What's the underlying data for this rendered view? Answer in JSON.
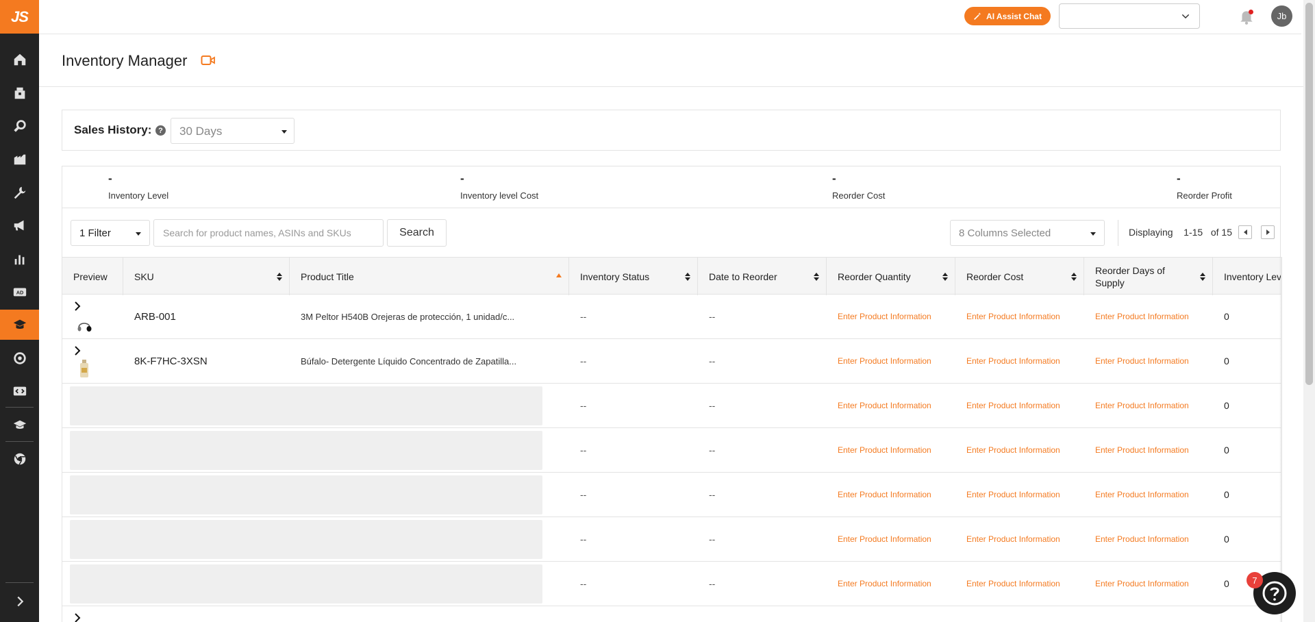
{
  "brand": {
    "logo_text": "JS",
    "accent": "#f47a20"
  },
  "topbar": {
    "ai_button": "AI Assist Chat",
    "marketplace_value": "",
    "avatar_initials": "Jb"
  },
  "page": {
    "title": "Inventory Manager"
  },
  "sales_history": {
    "label": "Sales History:",
    "help": "?",
    "value": "30 Days"
  },
  "stats": [
    {
      "value": "-",
      "label": "Inventory Level"
    },
    {
      "value": "-",
      "label": "Inventory level Cost"
    },
    {
      "value": "-",
      "label": "Reorder Cost"
    },
    {
      "value": "-",
      "label": "Reorder Profit"
    }
  ],
  "toolbar": {
    "filter_value": "1 Filter",
    "search_placeholder": "Search for product names, ASINs and SKUs",
    "search_button": "Search",
    "columns_value": "8 Columns Selected",
    "displaying_label": "Displaying",
    "range": "1-15",
    "of_total": "of 15"
  },
  "table": {
    "headers": [
      "Preview",
      "SKU",
      "Product Title",
      "Inventory Status",
      "Date to Reorder",
      "Reorder Quantity",
      "Reorder Cost",
      "Reorder Days of Supply",
      "Inventory Lev"
    ],
    "rows": [
      {
        "sku": "ARB-001",
        "title": "3M Peltor H540B Orejeras de protección, 1 unidad/c...",
        "status": "--",
        "date": "--",
        "qty": "Enter Product Information",
        "cost": "Enter Product Information",
        "days": "Enter Product Information",
        "level": "0"
      },
      {
        "sku": "8K-F7HC-3XSN",
        "title": "Búfalo- Detergente Líquido Concentrado de Zapatilla...",
        "status": "--",
        "date": "--",
        "qty": "Enter Product Information",
        "cost": "Enter Product Information",
        "days": "Enter Product Information",
        "level": "0"
      },
      {
        "sku": "",
        "title": "",
        "status": "--",
        "date": "--",
        "qty": "Enter Product Information",
        "cost": "Enter Product Information",
        "days": "Enter Product Information",
        "level": "0"
      },
      {
        "sku": "",
        "title": "",
        "status": "--",
        "date": "--",
        "qty": "Enter Product Information",
        "cost": "Enter Product Information",
        "days": "Enter Product Information",
        "level": "0"
      },
      {
        "sku": "",
        "title": "",
        "status": "--",
        "date": "--",
        "qty": "Enter Product Information",
        "cost": "Enter Product Information",
        "days": "Enter Product Information",
        "level": "0"
      },
      {
        "sku": "",
        "title": "",
        "status": "--",
        "date": "--",
        "qty": "Enter Product Information",
        "cost": "Enter Product Information",
        "days": "Enter Product Information",
        "level": "0"
      },
      {
        "sku": "",
        "title": "",
        "status": "--",
        "date": "--",
        "qty": "Enter Product Information",
        "cost": "Enter Product Information",
        "days": "Enter Product Information",
        "level": "0"
      }
    ]
  },
  "help_badge": "7"
}
